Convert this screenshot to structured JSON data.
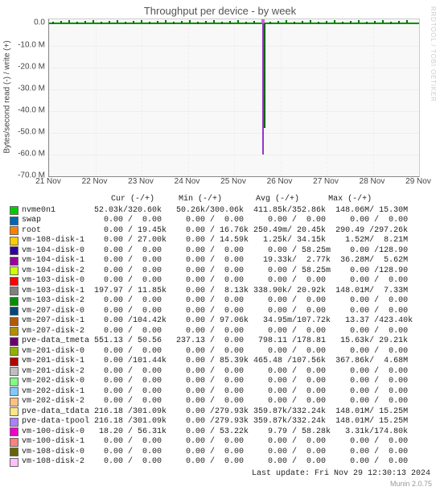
{
  "title": "Throughput per device - by week",
  "watermark": "RRDTOOL / TOBI OETIKER",
  "ylabel": "Bytes/second read (-) / write (+)",
  "yticks": [
    "0.0",
    "-10.0 M",
    "-20.0 M",
    "-30.0 M",
    "-40.0 M",
    "-50.0 M",
    "-60.0 M",
    "-70.0 M"
  ],
  "xticks": [
    "21 Nov",
    "22 Nov",
    "23 Nov",
    "24 Nov",
    "25 Nov",
    "26 Nov",
    "27 Nov",
    "28 Nov",
    "29 Nov"
  ],
  "legend_header": "                     Cur (-/+)     Min (-/+)       Avg (-/+)      Max (-/+)",
  "devices": [
    {
      "color": "#00cc00",
      "name": "nvme0n1      ",
      "cur": " 52.03k/320.60k",
      "min": " 50.26k/300.06k",
      "avg": "411.85k/352.86k",
      "max": "148.06M/ 15.30M"
    },
    {
      "color": "#0066b3",
      "name": "swap         ",
      "cur": "   0.00 /  0.00",
      "min": "   0.00 /  0.00",
      "avg": "   0.00 /  0.00",
      "max": "   0.00 /  0.00"
    },
    {
      "color": "#ff8000",
      "name": "root         ",
      "cur": "   0.00 / 19.45k",
      "min": "   0.00 / 16.76k",
      "avg": "250.49m/ 20.45k",
      "max": "290.49 /297.26k"
    },
    {
      "color": "#ffcc00",
      "name": "vm-108-disk-1",
      "cur": "   0.00 / 27.00k",
      "min": "   0.00 / 14.59k",
      "avg": "  1.25k/ 34.15k",
      "max": "  1.52M/  8.21M"
    },
    {
      "color": "#330099",
      "name": "vm-104-disk-0",
      "cur": "   0.00 /  0.00",
      "min": "   0.00 /  0.00",
      "avg": "   0.00 / 58.25m",
      "max": "   0.00 /128.90 "
    },
    {
      "color": "#990099",
      "name": "vm-104-disk-1",
      "cur": "   0.00 /  0.00",
      "min": "   0.00 /  0.00",
      "avg": "  19.33k/  2.77k",
      "max": " 36.28M/  5.62M"
    },
    {
      "color": "#ccff00",
      "name": "vm-104-disk-2",
      "cur": "   0.00 /  0.00",
      "min": "   0.00 /  0.00",
      "avg": "   0.00 / 58.25m",
      "max": "   0.00 /128.90 "
    },
    {
      "color": "#ff0000",
      "name": "vm-103-disk-0",
      "cur": "   0.00 /  0.00",
      "min": "   0.00 /  0.00",
      "avg": "   0.00 /  0.00",
      "max": "   0.00 /  0.00"
    },
    {
      "color": "#808080",
      "name": "vm-103-disk-1",
      "cur": " 197.97 / 11.85k",
      "min": "   0.00 /  8.13k",
      "avg": "338.90k/ 20.92k",
      "max": "148.01M/  7.33M"
    },
    {
      "color": "#008f00",
      "name": "vm-103-disk-2",
      "cur": "   0.00 /  0.00",
      "min": "   0.00 /  0.00",
      "avg": "   0.00 /  0.00",
      "max": "   0.00 /  0.00"
    },
    {
      "color": "#00487d",
      "name": "vm-207-disk-0",
      "cur": "   0.00 /  0.00",
      "min": "   0.00 /  0.00",
      "avg": "   0.00 /  0.00",
      "max": "   0.00 /  0.00"
    },
    {
      "color": "#b35a00",
      "name": "vm-207-disk-1",
      "cur": "   0.00 /104.42k",
      "min": "   0.00 / 97.06k",
      "avg": "  34.95m/107.72k",
      "max": "  13.37 /423.40k"
    },
    {
      "color": "#b38f00",
      "name": "vm-207-disk-2",
      "cur": "   0.00 /  0.00",
      "min": "   0.00 /  0.00",
      "avg": "   0.00 /  0.00",
      "max": "   0.00 /  0.00"
    },
    {
      "color": "#6b006b",
      "name": "pve-data_tmeta",
      "cur": " 551.13 / 50.56",
      "min": " 237.13 /  0.00",
      "avg": " 798.11 /178.81 ",
      "max": " 15.63k/ 29.21k"
    },
    {
      "color": "#8fb300",
      "name": "vm-201-disk-0",
      "cur": "   0.00 /  0.00",
      "min": "   0.00 /  0.00",
      "avg": "   0.00 /  0.00",
      "max": "   0.00 /  0.00"
    },
    {
      "color": "#b30000",
      "name": "vm-201-disk-1",
      "cur": "   0.00 /101.44k",
      "min": "   0.00 / 85.39k",
      "avg": "465.48 /107.56k",
      "max": "367.86k/  4.68M"
    },
    {
      "color": "#bebebe",
      "name": "vm-201-disk-2",
      "cur": "   0.00 /  0.00",
      "min": "   0.00 /  0.00",
      "avg": "   0.00 /  0.00",
      "max": "   0.00 /  0.00"
    },
    {
      "color": "#80ff80",
      "name": "vm-202-disk-0",
      "cur": "   0.00 /  0.00",
      "min": "   0.00 /  0.00",
      "avg": "   0.00 /  0.00",
      "max": "   0.00 /  0.00"
    },
    {
      "color": "#80c9ff",
      "name": "vm-202-disk-1",
      "cur": "   0.00 /  0.00",
      "min": "   0.00 /  0.00",
      "avg": "   0.00 /  0.00",
      "max": "   0.00 /  0.00"
    },
    {
      "color": "#ffc080",
      "name": "vm-202-disk-2",
      "cur": "   0.00 /  0.00",
      "min": "   0.00 /  0.00",
      "avg": "   0.00 /  0.00",
      "max": "   0.00 /  0.00"
    },
    {
      "color": "#ffe680",
      "name": "pve-data_tdata",
      "cur": " 216.18 /301.09k",
      "min": "   0.00 /279.93k",
      "avg": "359.87k/332.24k",
      "max": "148.01M/ 15.25M"
    },
    {
      "color": "#aa80ff",
      "name": "pve-data-tpool",
      "cur": " 216.18 /301.09k",
      "min": "   0.00 /279.93k",
      "avg": "359.87k/332.24k",
      "max": "148.01M/ 15.25M"
    },
    {
      "color": "#ee00cc",
      "name": "vm-100-disk-0",
      "cur": "  18.20 / 56.31k",
      "min": "   0.00 / 53.22k",
      "avg": "   9.79 / 58.28k",
      "max": "  3.31k/174.80k"
    },
    {
      "color": "#ff8080",
      "name": "vm-100-disk-1",
      "cur": "   0.00 /  0.00",
      "min": "   0.00 /  0.00",
      "avg": "   0.00 /  0.00",
      "max": "   0.00 /  0.00"
    },
    {
      "color": "#666600",
      "name": "vm-108-disk-0",
      "cur": "   0.00 /  0.00",
      "min": "   0.00 /  0.00",
      "avg": "   0.00 /  0.00",
      "max": "   0.00 /  0.00"
    },
    {
      "color": "#ffbfff",
      "name": "vm-108-disk-2",
      "cur": "   0.00 /  0.00",
      "min": "   0.00 /  0.00",
      "avg": "   0.00 /  0.00",
      "max": "   0.00 /  0.00"
    }
  ],
  "last_update": "Last update: Fri Nov 29 12:30:13 2024",
  "munin": "Munin 2.0.75",
  "chart_data": {
    "type": "line",
    "title": "Throughput per device - by week",
    "ylabel": "Bytes/second read (-) / write (+)",
    "ylim": [
      -70000000,
      2000000
    ],
    "x_range": [
      "21 Nov 2024",
      "29 Nov 2024"
    ],
    "x_ticks": [
      "21 Nov",
      "22 Nov",
      "23 Nov",
      "24 Nov",
      "25 Nov",
      "26 Nov",
      "27 Nov",
      "28 Nov",
      "29 Nov"
    ],
    "note": "Most device throughput lines remain near 0 across the week. Around ~25.5 Nov there is a sharp negative (read) spike reaching roughly -60 M, primarily attributed to nvme0n1 and related pve-data devices (correlates with Max read ≈148 M in legend). Small upward/downward noise (<±2 M) is visible across the top band throughout.",
    "series_summary": "See devices[] for per-series labels, colors, and Cur/Min/Avg/Max statistics shown in the legend."
  }
}
